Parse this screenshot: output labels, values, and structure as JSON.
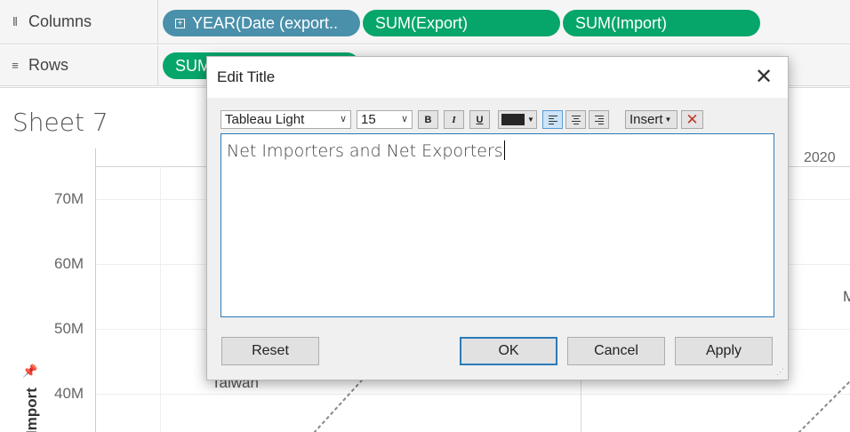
{
  "shelves": {
    "columns": {
      "label": "Columns",
      "icon": "columns-icon",
      "pills": [
        {
          "text": "YEAR(Date (export..",
          "color": "#4a90ab"
        },
        {
          "text": "SUM(Export)",
          "color": "#06a66a"
        },
        {
          "text": "SUM(Import)",
          "color": "#06a66a"
        }
      ]
    },
    "rows": {
      "label": "Rows",
      "icon": "rows-icon",
      "pills": [
        {
          "text": "SUM",
          "color": "#06a66a"
        }
      ]
    }
  },
  "sheet": {
    "title": "Sheet 7",
    "y_ticks": [
      "70M",
      "60M",
      "50M",
      "40M"
    ],
    "year_label": "2020",
    "axis_title": "Import",
    "mark_labels": [
      "Taiwan",
      "M"
    ]
  },
  "dialog": {
    "title": "Edit Title",
    "font_name": "Tableau Light",
    "font_size": "15",
    "bold": "B",
    "italic": "I",
    "underline": "U",
    "text_color": "#262626",
    "insert_label": "Insert",
    "text": "Net Importers and Net Exporters",
    "buttons": {
      "reset": "Reset",
      "ok": "OK",
      "cancel": "Cancel",
      "apply": "Apply"
    }
  }
}
